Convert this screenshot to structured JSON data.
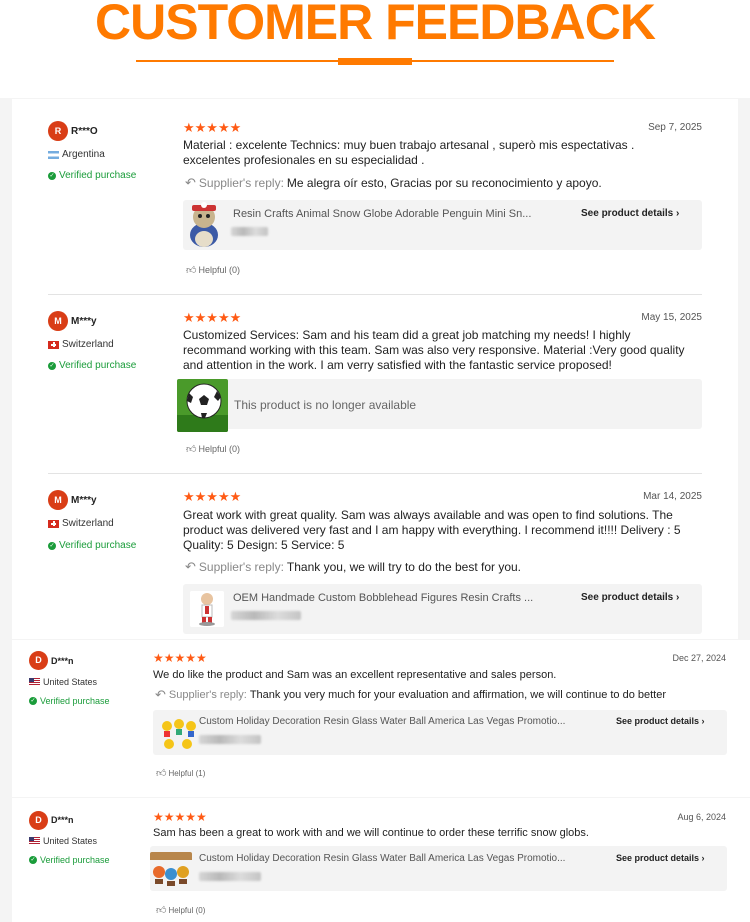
{
  "header": {
    "title": "CUSTOMER FEEDBACK"
  },
  "colors": {
    "accent": "#ff7a00",
    "star": "#ff5a14",
    "verified": "#1a9c3a",
    "avatar": "#d93d16"
  },
  "labels": {
    "verified": "Verified purchase",
    "supplier_reply": "Supplier's reply:",
    "see_details": "See product details",
    "unavailable": "This product is no longer available"
  },
  "reviews": [
    {
      "initial": "R",
      "name": "R***O",
      "country": "Argentina",
      "stars": "★★★★★",
      "date": "Sep 7, 2025",
      "text": "Material : excelente  Technics: muy buen trabajo artesanal ,  superò mis espectativas .  excelentes profesionales en su  especialidad .",
      "reply": "Me alegra oír esto, Gracias por su reconocimiento y apoyo.",
      "product": "Resin Crafts Animal Snow Globe Adorable Penguin Mini Sn...",
      "helpful": "Helpful (0)"
    },
    {
      "initial": "M",
      "name": "M***y",
      "country": "Switzerland",
      "stars": "★★★★★",
      "date": "May 15, 2025",
      "text": "Customized Services: Sam and his team did a great job matching my needs! I highly recommand working with this team. Sam was also very responsive. Material :Very good quality and attention in the work.  I am verry satisfied with the fantastic service proposed!",
      "helpful": "Helpful (0)"
    },
    {
      "initial": "M",
      "name": "M***y",
      "country": "Switzerland",
      "stars": "★★★★★",
      "date": "Mar 14, 2025",
      "text": "Great work with great quality. Sam was always available and was open to find solutions. The product was delivered very fast and I am happy with everything. I recommend it!!!! Delivery : 5 Quality: 5 Design: 5 Service: 5",
      "reply": "Thank you, we will try to do the best for you.",
      "product": "OEM Handmade Custom Bobblehead Figures Resin Crafts ..."
    },
    {
      "initial": "D",
      "name": "D***n",
      "country": "United States",
      "stars": "★★★★★",
      "date": "Dec 27, 2024",
      "text": "We do like the product and Sam was an excellent representative and sales person.",
      "reply": "Thank you very much for your evaluation and affirmation, we will continue to do better",
      "product": "Custom Holiday Decoration Resin Glass Water Ball America Las Vegas Promotio...",
      "helpful": "Helpful (1)"
    },
    {
      "initial": "D",
      "name": "D***n",
      "country": "United States",
      "stars": "★★★★★",
      "date": "Aug 6, 2024",
      "text": "Sam has been a great to work with and we will continue to order these terrific snow globs.",
      "product": "Custom Holiday Decoration Resin Glass Water Ball America Las Vegas Promotio...",
      "helpful": "Helpful (0)"
    }
  ]
}
